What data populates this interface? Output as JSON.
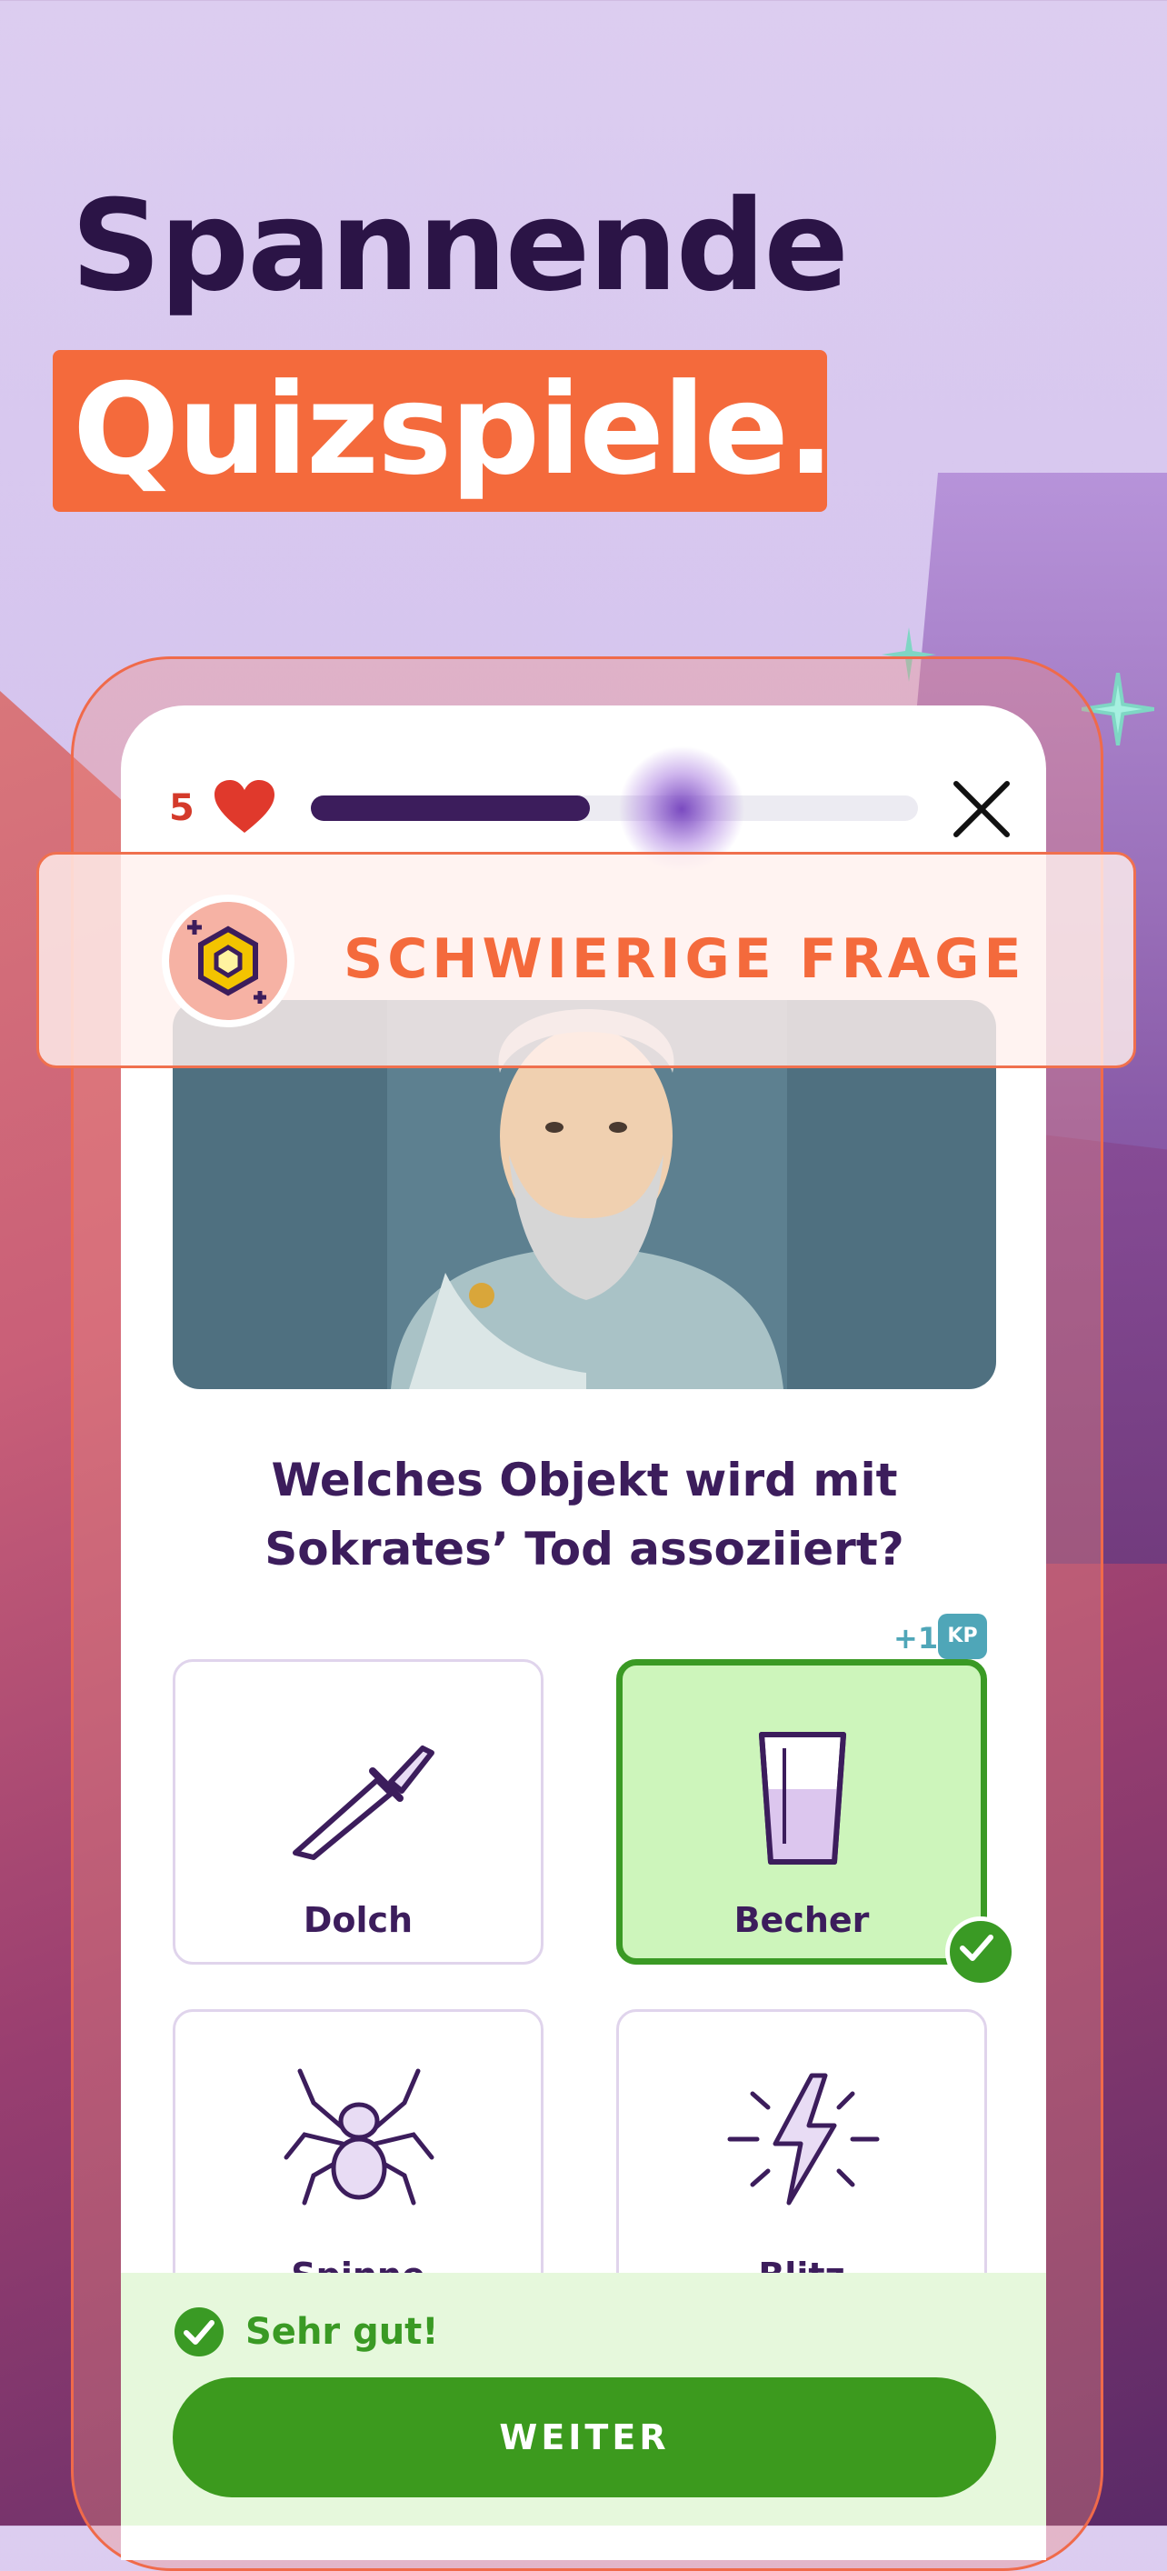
{
  "headline": {
    "line1": "Spannende",
    "line2": "Quizspiele."
  },
  "quiz": {
    "lives": "5",
    "progress": 0.46,
    "banner_label": "SCHWIERIGE FRAGE",
    "question": "Welches Objekt wird mit Sokrates’ Tod assoziiert?",
    "answers": [
      {
        "label": "Dolch",
        "icon": "dagger-icon",
        "correct": false
      },
      {
        "label": "Becher",
        "icon": "cup-icon",
        "correct": true
      },
      {
        "label": "Spinne",
        "icon": "spider-icon",
        "correct": false
      },
      {
        "label": "Blitz",
        "icon": "lightning-icon",
        "correct": false
      }
    ],
    "reward": {
      "plus": "+1",
      "badge": "KP"
    },
    "feedback": "Sehr gut!",
    "continue_label": "WEITER"
  },
  "colors": {
    "accent_orange": "#f46a3c",
    "primary_purple": "#3c1d5c",
    "success_green": "#3a9a24"
  }
}
